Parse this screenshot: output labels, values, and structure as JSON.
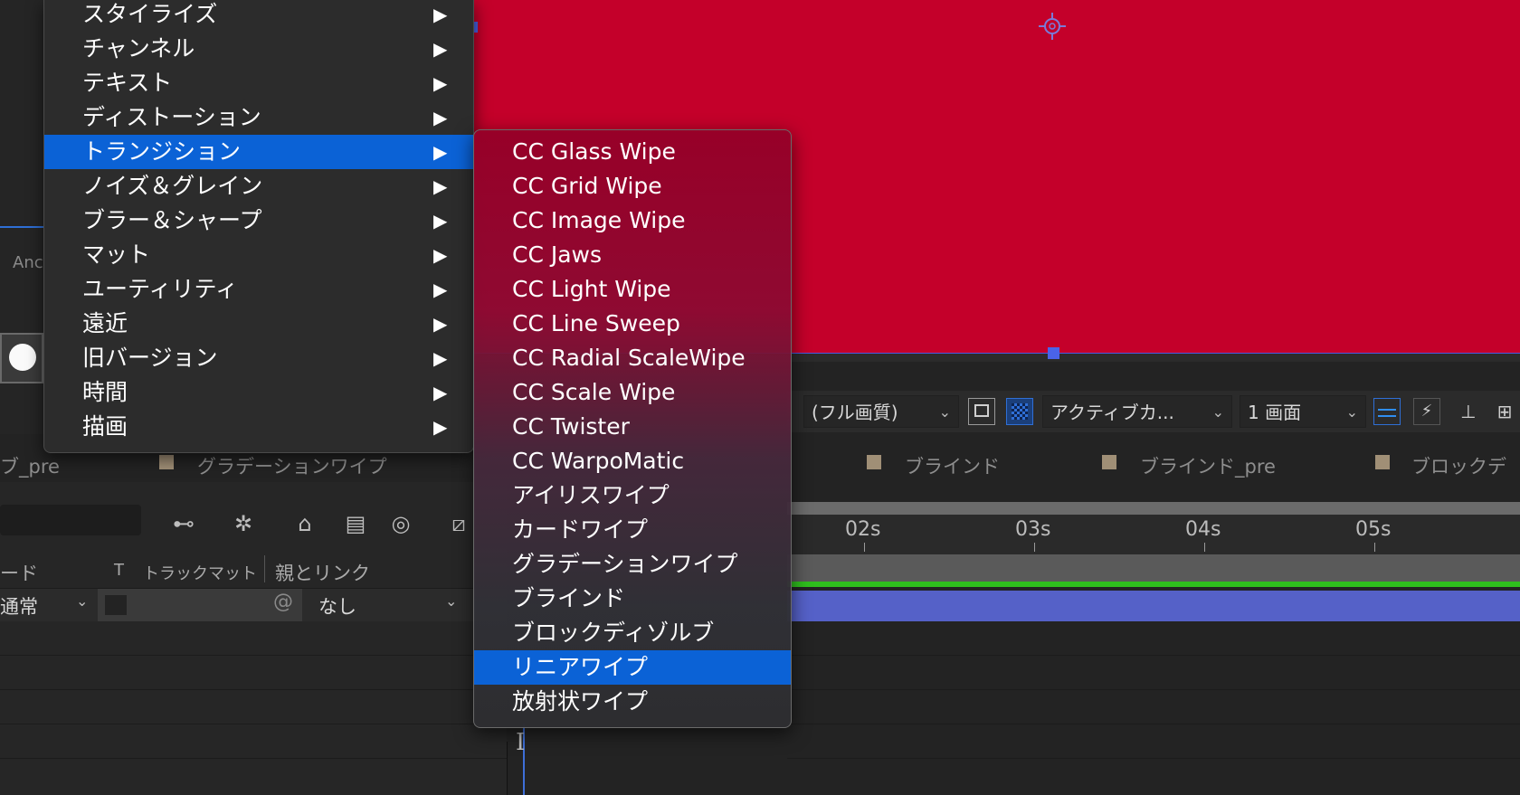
{
  "panels": {
    "left_partial_label": "Anc",
    "viewer_toolbar": {
      "resolution": "(フル画質)",
      "camera": "アクティブカ...",
      "views": "1 画面"
    },
    "comp_tabs": [
      {
        "label": "ブ_pre"
      },
      {
        "label": "グラデーションワイプ"
      },
      {
        "label": "ブラインド"
      },
      {
        "label": "ブラインド_pre"
      },
      {
        "label": "ブロックディ"
      }
    ],
    "timeline": {
      "columns": {
        "mode": "ード",
        "t": "T",
        "track_matte": "トラックマット",
        "parent": "親とリンク"
      },
      "row1": {
        "mode": "通常",
        "parent": "なし"
      },
      "ruler": [
        "02s",
        "03s",
        "04s",
        "05s"
      ]
    }
  },
  "main_menu": {
    "items": [
      {
        "label": "スタイライズ",
        "arrow": "▶"
      },
      {
        "label": "チャンネル",
        "arrow": "▶"
      },
      {
        "label": "テキスト",
        "arrow": "▶"
      },
      {
        "label": "ディストーション",
        "arrow": "▶"
      },
      {
        "label": "トランジション",
        "arrow": "▶",
        "selected": true
      },
      {
        "label": "ノイズ＆グレイン",
        "arrow": "▶"
      },
      {
        "label": "ブラー＆シャープ",
        "arrow": "▶"
      },
      {
        "label": "マット",
        "arrow": "▶"
      },
      {
        "label": "ユーティリティ",
        "arrow": "▶"
      },
      {
        "label": "遠近",
        "arrow": "▶"
      },
      {
        "label": "旧バージョン",
        "arrow": "▶"
      },
      {
        "label": "時間",
        "arrow": "▶"
      },
      {
        "label": "描画",
        "arrow": "▶"
      }
    ]
  },
  "submenu": {
    "items": [
      {
        "label": "CC Glass Wipe"
      },
      {
        "label": "CC Grid Wipe"
      },
      {
        "label": "CC Image Wipe"
      },
      {
        "label": "CC Jaws"
      },
      {
        "label": "CC Light Wipe"
      },
      {
        "label": "CC Line Sweep"
      },
      {
        "label": "CC Radial ScaleWipe"
      },
      {
        "label": "CC Scale Wipe"
      },
      {
        "label": "CC Twister"
      },
      {
        "label": "CC WarpoMatic"
      },
      {
        "label": "アイリスワイプ"
      },
      {
        "label": "カードワイプ"
      },
      {
        "label": "グラデーションワイプ"
      },
      {
        "label": "ブラインド"
      },
      {
        "label": "ブロックディゾルブ"
      },
      {
        "label": "リニアワイプ",
        "selected": true
      },
      {
        "label": "放射状ワイプ"
      }
    ]
  },
  "colors": {
    "comp_background": "#c4002a",
    "selection": "#0b62d6",
    "layer_bar": "#5561c8",
    "work_area_green": "#2fbf1d"
  }
}
